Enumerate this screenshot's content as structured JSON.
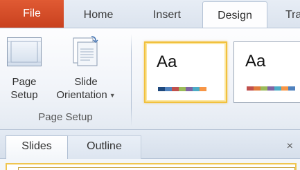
{
  "tabs": {
    "file": "File",
    "home": "Home",
    "insert": "Insert",
    "design": "Design",
    "transitions": "Tra"
  },
  "ribbon": {
    "page_setup": {
      "line1": "Page",
      "line2": "Setup",
      "icon": "page-setup-icon"
    },
    "slide_orientation": {
      "line1": "Slide",
      "line2": "Orientation",
      "icon": "slide-orientation-icon"
    },
    "group_label": "Page Setup",
    "themes": [
      {
        "label": "Aa",
        "selected": true,
        "colors": [
          "#1f497d",
          "#4f81bd",
          "#c0504d",
          "#9bbb59",
          "#8064a2",
          "#4bacc6",
          "#f79646"
        ]
      },
      {
        "label": "Aa",
        "selected": false,
        "colors": [
          "#c0504d",
          "#e07a3b",
          "#9bbb59",
          "#8064a2",
          "#4bacc6",
          "#f79646",
          "#4f81bd"
        ]
      }
    ]
  },
  "pane": {
    "tabs": {
      "slides": "Slides",
      "outline": "Outline"
    },
    "close": "×"
  },
  "colors": {
    "file_tab": "#d04a27",
    "ribbon_bg": "#f1f4f9",
    "selected_border": "#f1c13d"
  }
}
